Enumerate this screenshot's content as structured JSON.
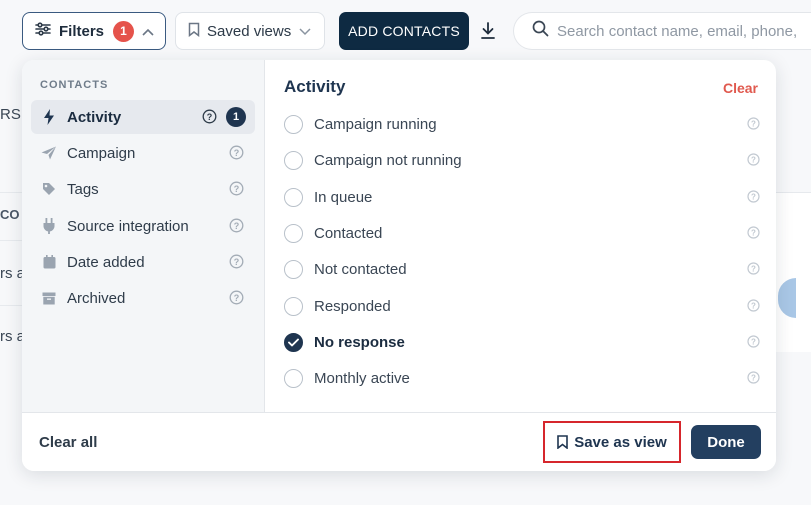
{
  "toolbar": {
    "filters_label": "Filters",
    "filters_count": "1",
    "saved_views_label": "Saved views",
    "add_contacts_label": "ADD CONTACTS",
    "search_placeholder": "Search contact name, email, phone,"
  },
  "background": {
    "frag_rs": "RS",
    "frag_col": "CO",
    "frag_row1": "rs a",
    "frag_row2": "rs a"
  },
  "filter_panel": {
    "section_heading": "CONTACTS",
    "categories": [
      {
        "label": "Activity",
        "icon": "bolt-icon",
        "active": true,
        "badge": "1"
      },
      {
        "label": "Campaign",
        "icon": "paper-plane-icon"
      },
      {
        "label": "Tags",
        "icon": "tag-icon"
      },
      {
        "label": "Source integration",
        "icon": "plug-icon"
      },
      {
        "label": "Date added",
        "icon": "calendar-icon"
      },
      {
        "label": "Archived",
        "icon": "archive-icon"
      }
    ],
    "activity": {
      "title": "Activity",
      "clear_label": "Clear",
      "options": [
        {
          "label": "Campaign running",
          "checked": false
        },
        {
          "label": "Campaign not running",
          "checked": false
        },
        {
          "label": "In queue",
          "checked": false
        },
        {
          "label": "Contacted",
          "checked": false
        },
        {
          "label": "Not contacted",
          "checked": false
        },
        {
          "label": "Responded",
          "checked": false
        },
        {
          "label": "No response",
          "checked": true
        },
        {
          "label": "Monthly active",
          "checked": false
        }
      ]
    },
    "footer": {
      "clear_all_label": "Clear all",
      "save_view_label": "Save as view",
      "done_label": "Done"
    }
  },
  "colors": {
    "primary_dark": "#0e2a42",
    "accent_navy": "#1f3550",
    "badge_red": "#e5534b",
    "clear_red": "#e0594e",
    "highlight_red": "#d6262c"
  }
}
